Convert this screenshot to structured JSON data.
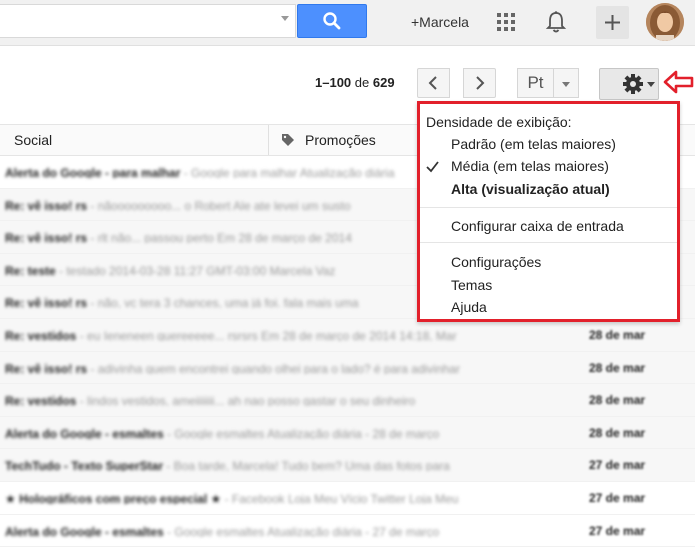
{
  "header": {
    "user_label": "+Marcela"
  },
  "toolbar": {
    "range": "1–100",
    "of_label": "de",
    "total": "629",
    "language_button": "Pt"
  },
  "tabs": [
    {
      "label": "Social"
    },
    {
      "label": "Promoções"
    }
  ],
  "settings_menu": {
    "density_heading": "Densidade de exibição:",
    "density_options": [
      {
        "label": "Padrão (em telas maiores)",
        "selected": false,
        "current": false
      },
      {
        "label": "Média (em telas maiores)",
        "selected": true,
        "current": false
      },
      {
        "label": "Alta (visualização atual)",
        "selected": false,
        "current": true
      }
    ],
    "configure_inbox": "Configurar caixa de entrada",
    "settings": "Configurações",
    "themes": "Temas",
    "help": "Ajuda"
  },
  "messages": [
    {
      "sender": "Alerta do Google - para malhar",
      "snippet": " - Google para malhar Atualização diária"
    },
    {
      "sender": "Re: vê isso! rs",
      "snippet": " - nãooooooooo... o Robert Ale ate levei um susto"
    },
    {
      "sender": "Re: vê isso! rs",
      "snippet": " - rlt não... passou perto Em 28 de março de 2014"
    },
    {
      "sender": "Re: teste",
      "snippet": " - testado 2014-03-28 11:27 GMT-03:00 Marcela Vaz"
    },
    {
      "sender": "Re: vê isso! rs",
      "snippet": " - não, vc tera 3 chances, uma já foi. fala mais uma"
    },
    {
      "sender": "Re: vestidos",
      "snippet": " - eu Ieneneen quereeeee... rsrsrs Em 28 de março de 2014 14:18, Mar",
      "date": "28 de mar"
    },
    {
      "sender": "Re: vê isso! rs",
      "snippet": " - adivinha quem encontrei quando olhei para o lado? é para adivinhar",
      "date": "28 de mar"
    },
    {
      "sender": "Re: vestidos",
      "snippet": " - lindos vestidos, ameiiiiiii... ah nao posso gastar o seu dinheiro",
      "date": "28 de mar"
    },
    {
      "sender": "Alerta do Google - esmaltes",
      "snippet": " - Google esmaltes Atualização diária - 28 de março",
      "date": "28 de mar"
    },
    {
      "sender": "TechTudo - Texto SuperStar",
      "snippet": " - Boa tarde, Marcela! Tudo bem? Uma das fotos para",
      "date": "27 de mar"
    },
    {
      "sender": "★ Holográficos com preço especial ★",
      "snippet": " - Facebook Loja Meu Vício Twitter Loja Meu",
      "date": "27 de mar"
    },
    {
      "sender": "Alerta do Google - esmaltes",
      "snippet": " - Google esmaltes Atualização diária - 27 de março",
      "date": "27 de mar"
    }
  ]
}
